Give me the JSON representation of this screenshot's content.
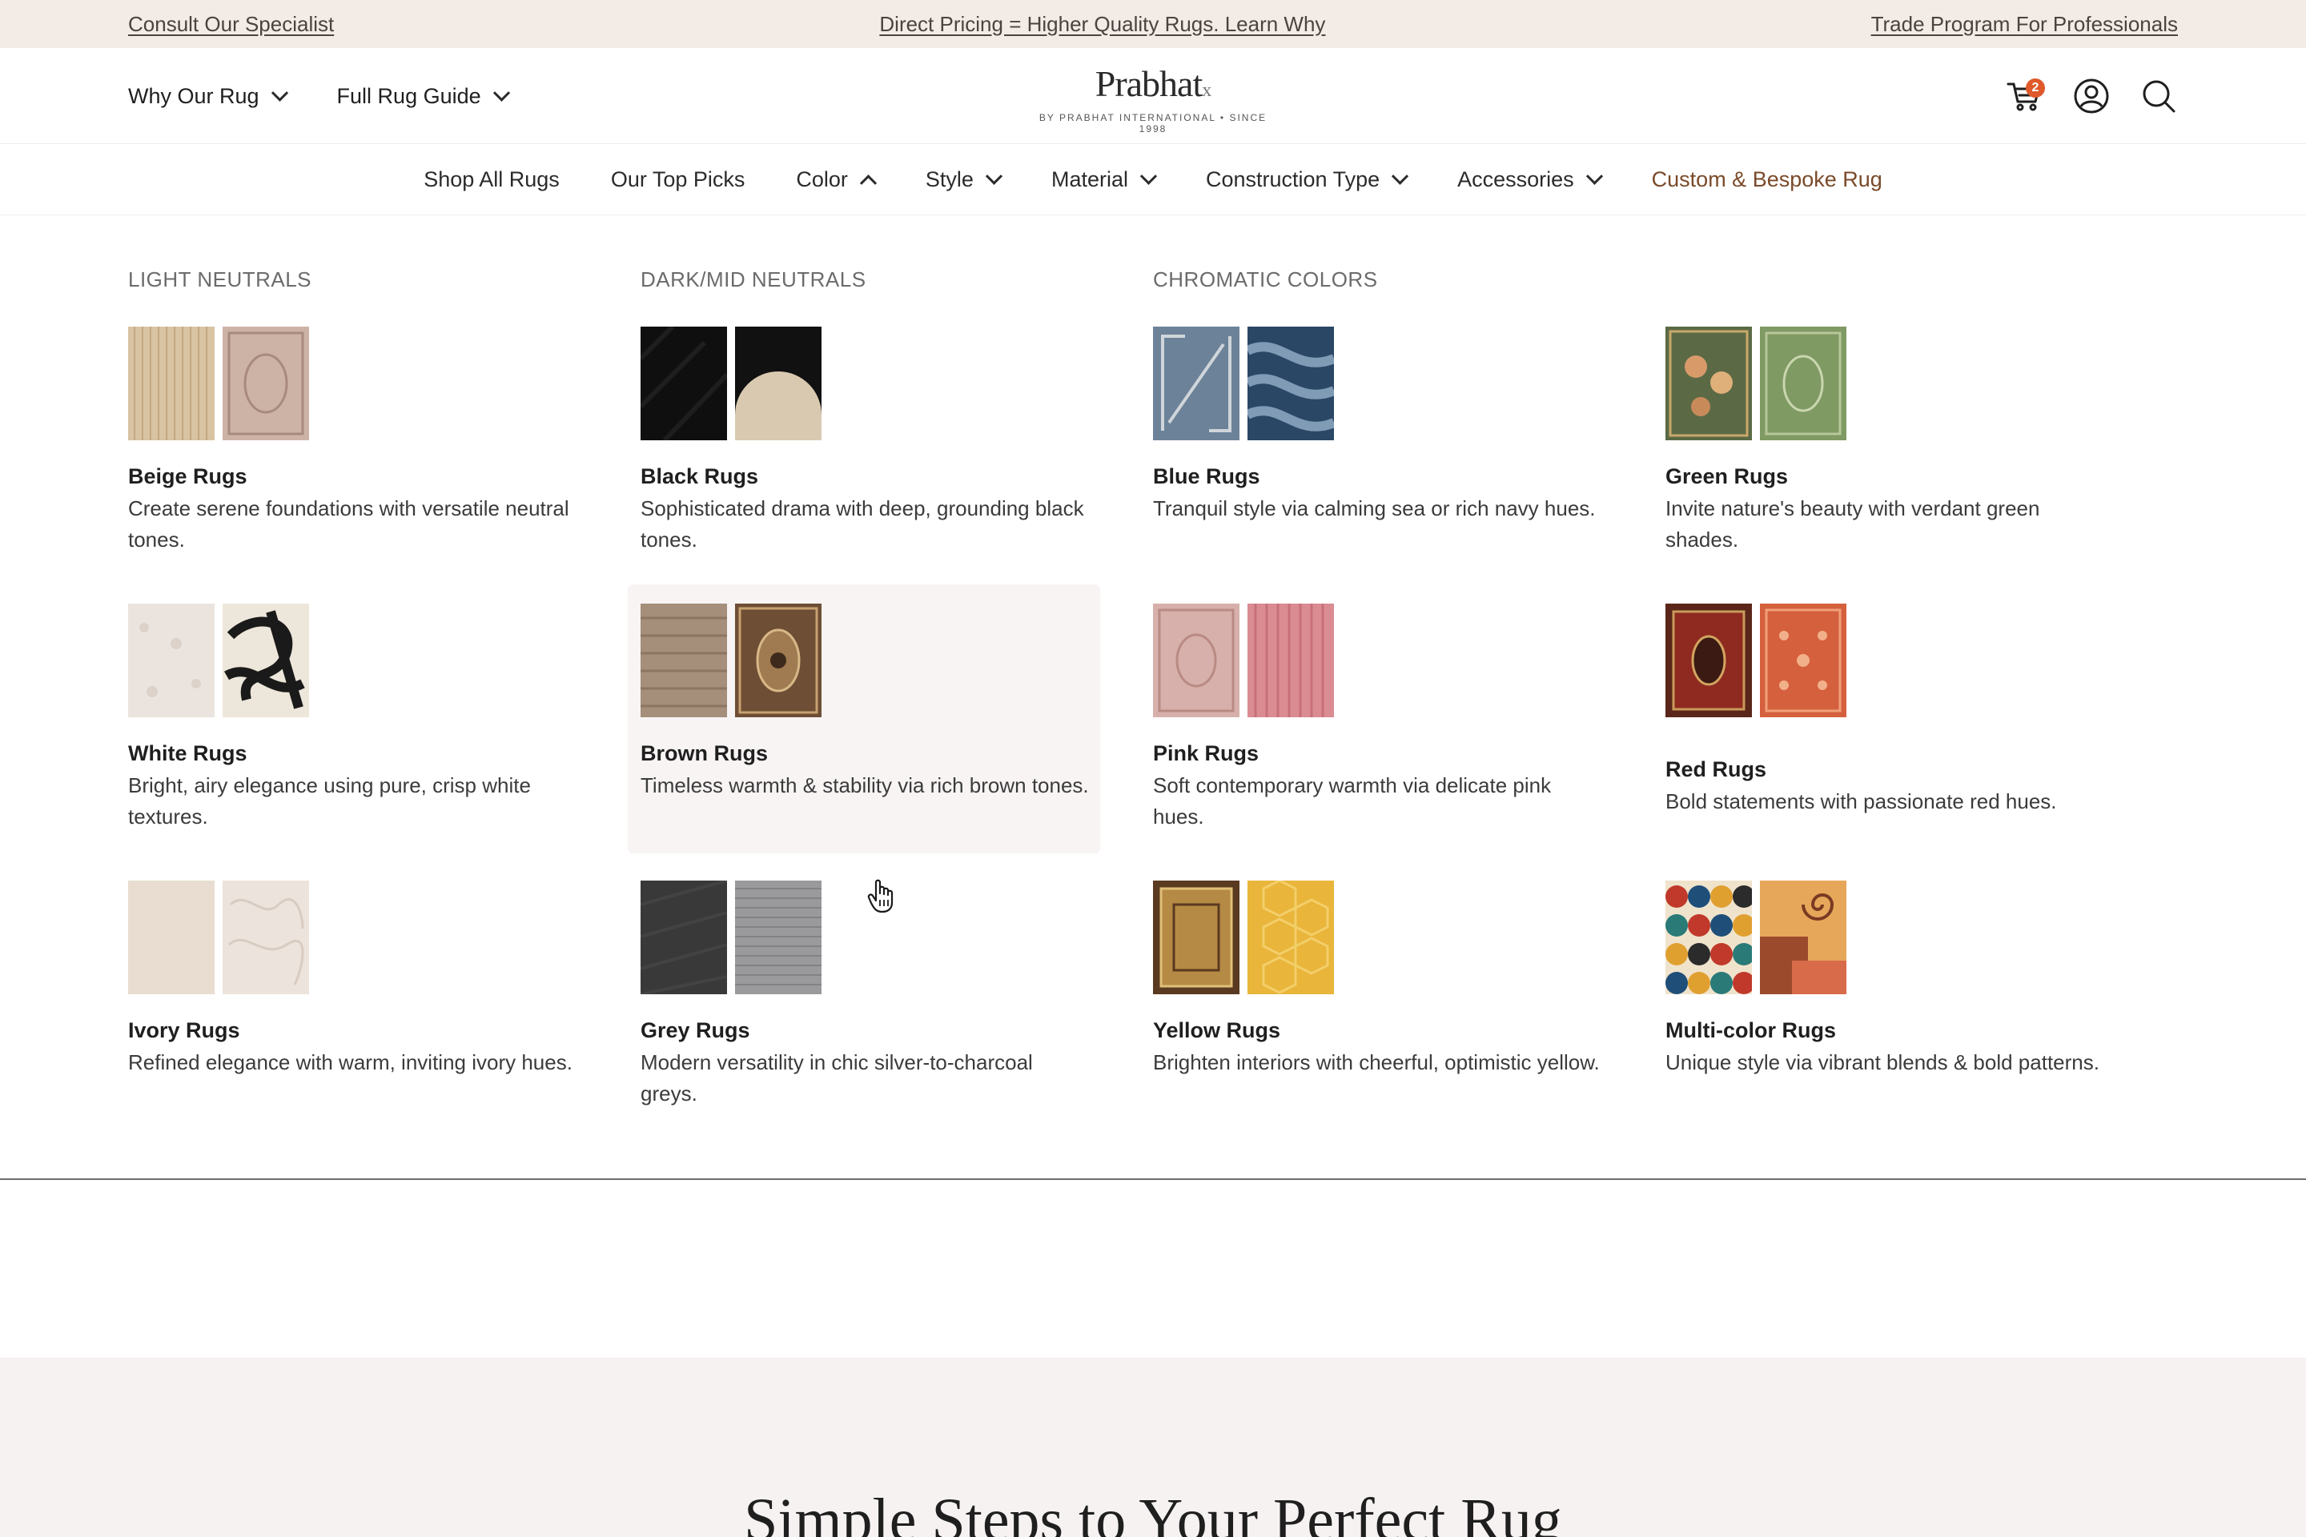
{
  "topbar": {
    "left_link": "Consult Our Specialist",
    "center_link": "Direct Pricing = Higher Quality Rugs. Learn Why",
    "right_link": "Trade Program For Professionals"
  },
  "header": {
    "left_nav": [
      "Why Our Rug",
      "Full Rug Guide"
    ],
    "logo_text": "Prabhat",
    "logo_mark": "x",
    "logo_tagline": "BY PRABHAT INTERNATIONAL • SINCE 1998",
    "cart_count": "2",
    "icons": [
      "cart-icon",
      "account-icon",
      "search-icon"
    ]
  },
  "main_nav": {
    "items": [
      {
        "label": "Shop All Rugs"
      },
      {
        "label": "Our Top Picks"
      },
      {
        "label": "Color"
      },
      {
        "label": "Style"
      },
      {
        "label": "Material"
      },
      {
        "label": "Construction Type"
      },
      {
        "label": "Accessories"
      },
      {
        "label": "Custom & Bespoke Rug"
      }
    ],
    "accent_color": "#7a4a2a"
  },
  "mega_menu": {
    "columns": [
      {
        "heading": "LIGHT NEUTRALS"
      },
      {
        "heading": "DARK/MID NEUTRALS"
      },
      {
        "heading": "CHROMATIC COLORS"
      }
    ],
    "cards": [
      {
        "title": "Beige Rugs",
        "desc": "Create serene foundations with versatile neutral tones."
      },
      {
        "title": "Black Rugs",
        "desc": "Sophisticated drama with deep, grounding black tones."
      },
      {
        "title": "Blue Rugs",
        "desc": "Tranquil style via calming sea or rich navy hues."
      },
      {
        "title": "Green Rugs",
        "desc": "Invite nature's beauty with verdant green shades."
      },
      {
        "title": "White Rugs",
        "desc": "Bright, airy elegance using pure, crisp white textures."
      },
      {
        "title": "Brown Rugs",
        "desc": "Timeless warmth & stability via rich brown tones."
      },
      {
        "title": "Pink Rugs",
        "desc": "Soft contemporary warmth via delicate pink hues."
      },
      {
        "title": "Red Rugs",
        "desc": "Bold statements with passionate red hues."
      },
      {
        "title": "Ivory Rugs",
        "desc": "Refined elegance with warm, inviting ivory hues."
      },
      {
        "title": "Grey Rugs",
        "desc": "Modern versatility in chic silver-to-charcoal greys."
      },
      {
        "title": "Yellow Rugs",
        "desc": "Brighten interiors with cheerful, optimistic yellow."
      },
      {
        "title": "Multi-color Rugs",
        "desc": "Unique style via vibrant blends & bold patterns."
      }
    ]
  },
  "lower_section": {
    "heading": "Simple Steps to Your Perfect Rug"
  }
}
